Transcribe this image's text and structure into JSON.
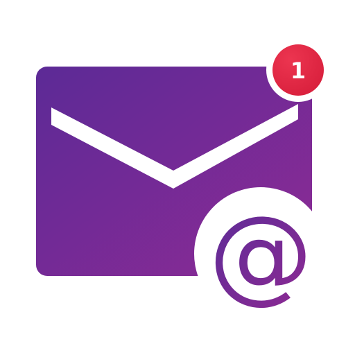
{
  "icon": {
    "name": "envelope-mail-icon",
    "badge": {
      "count": "1",
      "color": "#d81f3c",
      "highlight_color": "#ec3550",
      "text_color": "#ffffff",
      "ring_color": "#ffffff"
    },
    "envelope": {
      "gradient_start": "#5c2a96",
      "gradient_end": "#8d2b95",
      "flap_color": "#ffffff"
    },
    "at_symbol": {
      "glyph": "@",
      "gradient_start": "#5a2c98",
      "gradient_end": "#8f2a92",
      "background": "#ffffff"
    }
  }
}
